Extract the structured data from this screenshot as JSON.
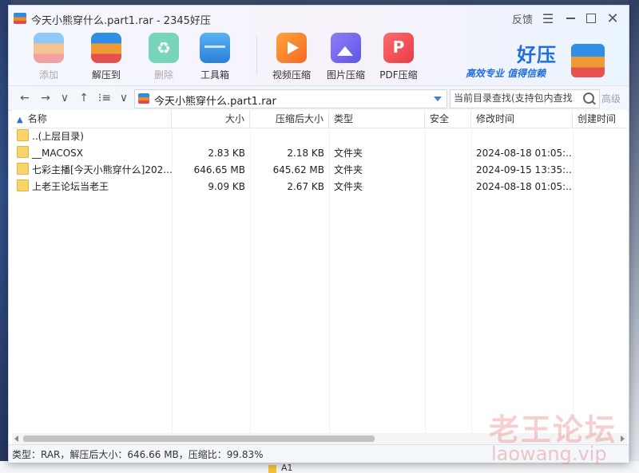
{
  "window": {
    "title": "今天小熊穿什么.part1.rar - 2345好压",
    "feedback": "反馈",
    "menu": "☰",
    "close": "✕"
  },
  "toolbar": {
    "tools": [
      {
        "label": "添加",
        "icon": "archive-add-icon",
        "disabled": true
      },
      {
        "label": "解压到",
        "icon": "extract-icon",
        "disabled": false
      },
      {
        "label": "删除",
        "icon": "recycle-icon",
        "disabled": true
      },
      {
        "label": "工具箱",
        "icon": "toolbox-icon",
        "disabled": false
      },
      {
        "label": "视频压缩",
        "icon": "video-compress-icon",
        "disabled": false
      },
      {
        "label": "图片压缩",
        "icon": "image-compress-icon",
        "disabled": false
      },
      {
        "label": "PDF压缩",
        "icon": "pdf-compress-icon",
        "disabled": false
      }
    ]
  },
  "brand": {
    "name": "好压",
    "slogan": "高效专业  值得信赖"
  },
  "addressbar": {
    "back": "←",
    "forward": "→",
    "history": "∨",
    "up": "↑",
    "view": "⁝≡",
    "view_drop": "∨",
    "path": "今天小熊穿什么.part1.rar",
    "search_placeholder": "当前目录查找(支持包内查找)",
    "advanced": "高级"
  },
  "columns": {
    "name": "名称",
    "size": "大小",
    "compressed": "压缩后大小",
    "type": "类型",
    "security": "安全",
    "modified": "修改时间",
    "created": "创建时间"
  },
  "rows": [
    {
      "name": "..(上层目录)",
      "size": "",
      "compressed": "",
      "type": "",
      "security": "",
      "modified": "",
      "created": ""
    },
    {
      "name": "__MACOSX",
      "size": "2.83 KB",
      "compressed": "2.18 KB",
      "type": "文件夹",
      "security": "",
      "modified": "2024-08-18 01:05:...",
      "created": ""
    },
    {
      "name": "七彩主播[今天小熊穿什么]202...",
      "size": "646.65 MB",
      "compressed": "645.62 MB",
      "type": "文件夹",
      "security": "",
      "modified": "2024-09-15 13:35:...",
      "created": ""
    },
    {
      "name": "上老王论坛当老王",
      "size": "9.09 KB",
      "compressed": "2.67 KB",
      "type": "文件夹",
      "security": "",
      "modified": "2024-08-18 01:05:...",
      "created": ""
    }
  ],
  "status": {
    "text": "类型：RAR，解压后大小：646.66 MB，压缩比：99.83%"
  },
  "watermark": {
    "text": "老王论坛",
    "url": "laowang.vip"
  },
  "desktop": {
    "folder_label": "A1"
  },
  "colors": {
    "accent": "#1f6fe0",
    "folder": "#f8d46b"
  }
}
